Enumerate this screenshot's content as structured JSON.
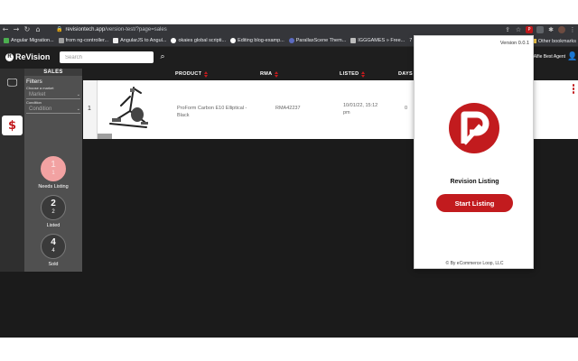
{
  "browser": {
    "url_host": "revisiontech.app",
    "url_path": "/version-test/?page=sales",
    "bookmarks": [
      {
        "label": "Angular Migration...",
        "icon_color": "#4caf50"
      },
      {
        "label": "from ng-controller...",
        "icon_color": "#9e9e9e"
      },
      {
        "label": "AngularJS to Angul...",
        "icon_color": "#eeeeee"
      },
      {
        "label": "okaies global scripti...",
        "icon_color": "#ffffff"
      },
      {
        "label": "Editing blog-examp...",
        "icon_color": "#ffffff"
      },
      {
        "label": "ParallaxScene Them...",
        "icon_color": "#5c6bc0"
      },
      {
        "label": "IGGGAMES » Free...",
        "icon_color": "#bdbdbd"
      },
      {
        "label": "7",
        "icon_color": "#35363a"
      }
    ],
    "other_bookmarks": "Other bookmarks"
  },
  "header": {
    "logo_text": "ReVision",
    "search_placeholder": "Search",
    "agent_name": "Alfie Best Agent"
  },
  "sidebar": {
    "title": "SALES",
    "filters_title": "Filters",
    "market_label": "Choose a market",
    "market_value": "Market",
    "condition_label": "Condition",
    "condition_value": "Condition",
    "statuses": [
      {
        "big": "1",
        "small": "1",
        "label": "Needs Listing",
        "highlight": true
      },
      {
        "big": "2",
        "small": "2",
        "label": "Listed",
        "highlight": false
      },
      {
        "big": "4",
        "small": "4",
        "label": "Sold",
        "highlight": false
      }
    ]
  },
  "table": {
    "columns": {
      "product": "PRODUCT",
      "rma": "RMA",
      "listed": "LISTED",
      "days": "DAYS L"
    },
    "rows": [
      {
        "index": "1",
        "product": "ProForm Carbon E10 Elliptical - Black",
        "rma": "RMA42237",
        "listed": "10/01/22, 15:12 pm",
        "days": "0"
      }
    ]
  },
  "popup": {
    "version": "Version 0.0.1",
    "title": "Revision Listing",
    "button": "Start Listing",
    "footer": "© By eCommerce Loop, LLC"
  },
  "colors": {
    "accent": "#c21b1e",
    "needs_listing": "#f2a2a2"
  }
}
